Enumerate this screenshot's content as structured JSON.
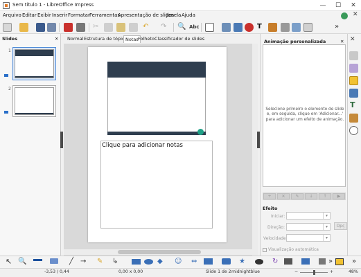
{
  "window": {
    "title": "Sem título 1 - LibreOffice Impress",
    "minimize": "—",
    "maximize": "☐",
    "close": "✕"
  },
  "menu": {
    "items": [
      "Arquivo",
      "Editar",
      "Exibir",
      "Inserir",
      "Formatar",
      "Ferramentas",
      "Apresentação de slides",
      "Janela",
      "Ajuda"
    ],
    "close_doc": "✕"
  },
  "slides_panel": {
    "title": "Slides",
    "close": "✕",
    "thumbs": [
      "1",
      "2"
    ]
  },
  "view_tabs": [
    "Normal",
    "Estrutura de tópicos",
    "Notas",
    "Folheto",
    "Classificador de slides"
  ],
  "active_tab": "Notas",
  "notes": {
    "placeholder": "Clique para adicionar notas"
  },
  "animation_panel": {
    "title": "Animação personalizada",
    "close": "✕",
    "message": "Selecione primeiro o elemento de slide e, em seguida, clique em 'Adicionar...' para adicionar um efeito de animação.",
    "buttons": [
      "+",
      "✕",
      "✎",
      "↓",
      "↑",
      "▶"
    ],
    "effect_label": "Efeito",
    "start_label": "Iniciar:",
    "direction_label": "Direção:",
    "speed_label": "Velocidade:",
    "options_button": "Opç",
    "auto_preview": "Visualização automática"
  },
  "status": {
    "position": "-3,53 / 0,44",
    "size": "0,00 x 0,00",
    "slide": "Slide 1 de 2",
    "master": "midnightblue",
    "zoom": "48%",
    "zoom_minus": "−",
    "zoom_plus": "+"
  },
  "colors": {
    "accent": "#4f8ad6",
    "slide_dark": "#2f3e4f",
    "slide_dot": "#1fa187"
  }
}
